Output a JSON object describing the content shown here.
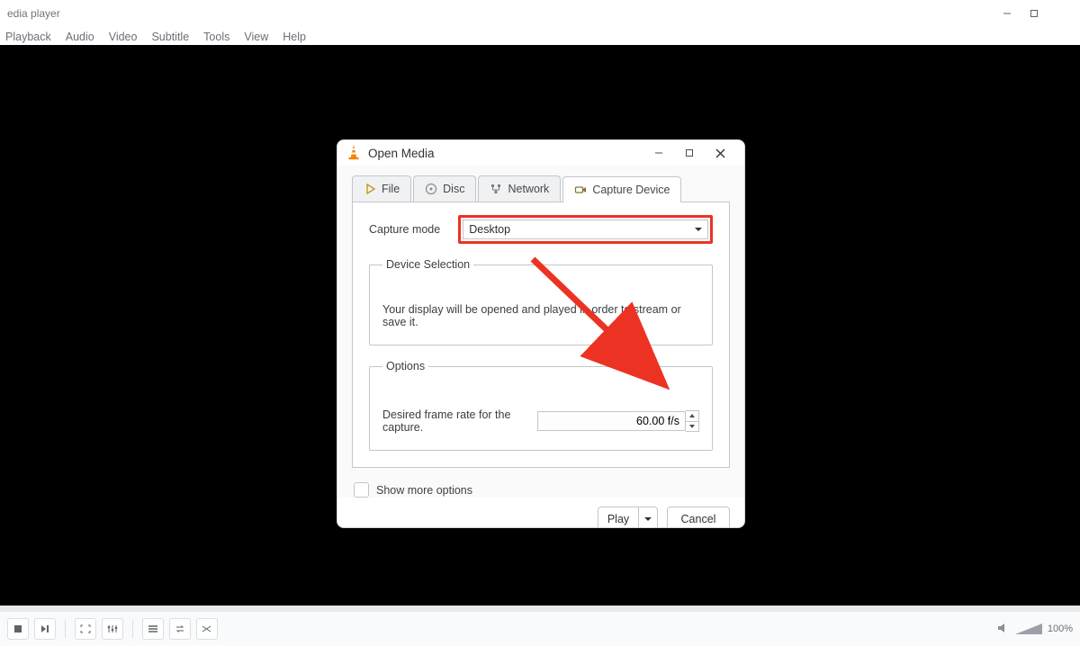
{
  "main": {
    "title": "edia player",
    "menu": [
      "Playback",
      "Audio",
      "Video",
      "Subtitle",
      "Tools",
      "View",
      "Help"
    ],
    "volume_label": "100%"
  },
  "dialog": {
    "title": "Open Media",
    "tabs": {
      "file": "File",
      "disc": "Disc",
      "network": "Network",
      "capture": "Capture Device"
    },
    "capture_mode_label": "Capture mode",
    "capture_mode_value": "Desktop",
    "device_selection_legend": "Device Selection",
    "device_selection_msg": "Your display will be opened and played in order to stream or save it.",
    "options_legend": "Options",
    "framerate_label": "Desired frame rate for the capture.",
    "framerate_value": "60.00 f/s",
    "show_more_label": "Show more options",
    "play_label": "Play",
    "cancel_label": "Cancel"
  },
  "annotation": {
    "color": "#ec3323"
  }
}
